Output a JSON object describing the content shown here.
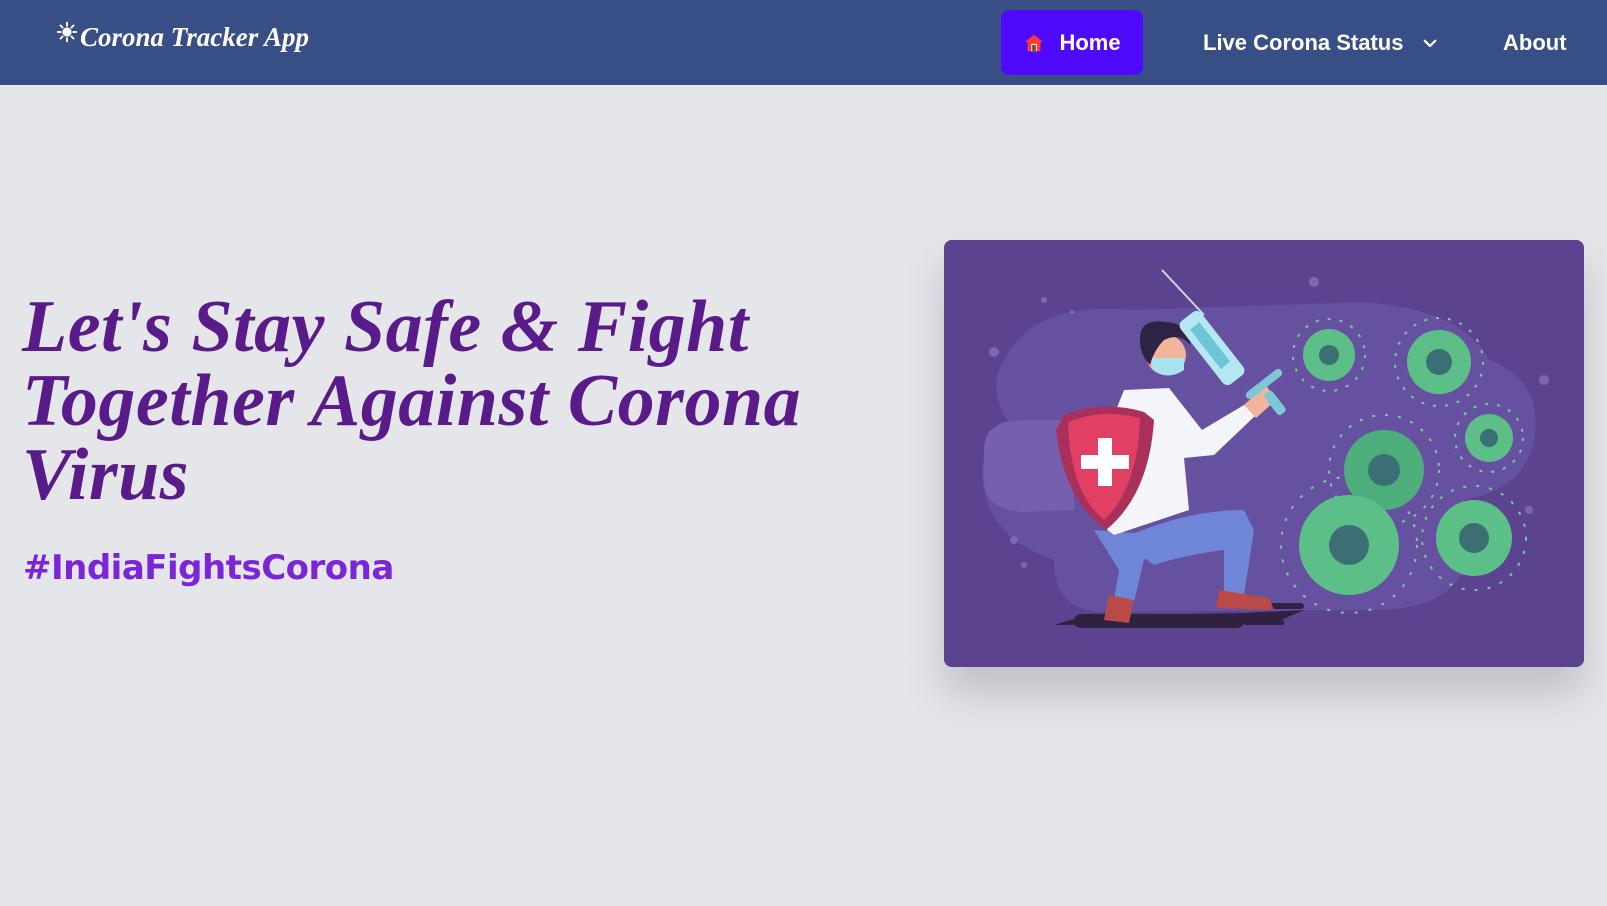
{
  "navbar": {
    "brand": {
      "icon": "virus-icon",
      "title": "Corona Tracker App"
    },
    "links": [
      {
        "label": "Home",
        "icon": "home-icon",
        "active": true
      },
      {
        "label": "Live Corona Status",
        "icon": "chevron-down-icon",
        "active": false
      },
      {
        "label": "About",
        "active": false
      }
    ]
  },
  "hero": {
    "headline_line1": "Let's Stay Safe & Fight",
    "headline_line2": "Together Against Corona",
    "headline_line3": "Virus",
    "hashtag": "#IndiaFightsCorona",
    "illustration": "doctor-with-shield-and-syringe-fighting-virus-illustration"
  },
  "colors": {
    "navbar_bg": "#384f86",
    "active_nav_bg": "#4f0afc",
    "page_bg": "#e5e6ea",
    "headline": "#5a1b8a",
    "hashtag": "#7b26d6",
    "illustration_bg": "#5b4390"
  }
}
